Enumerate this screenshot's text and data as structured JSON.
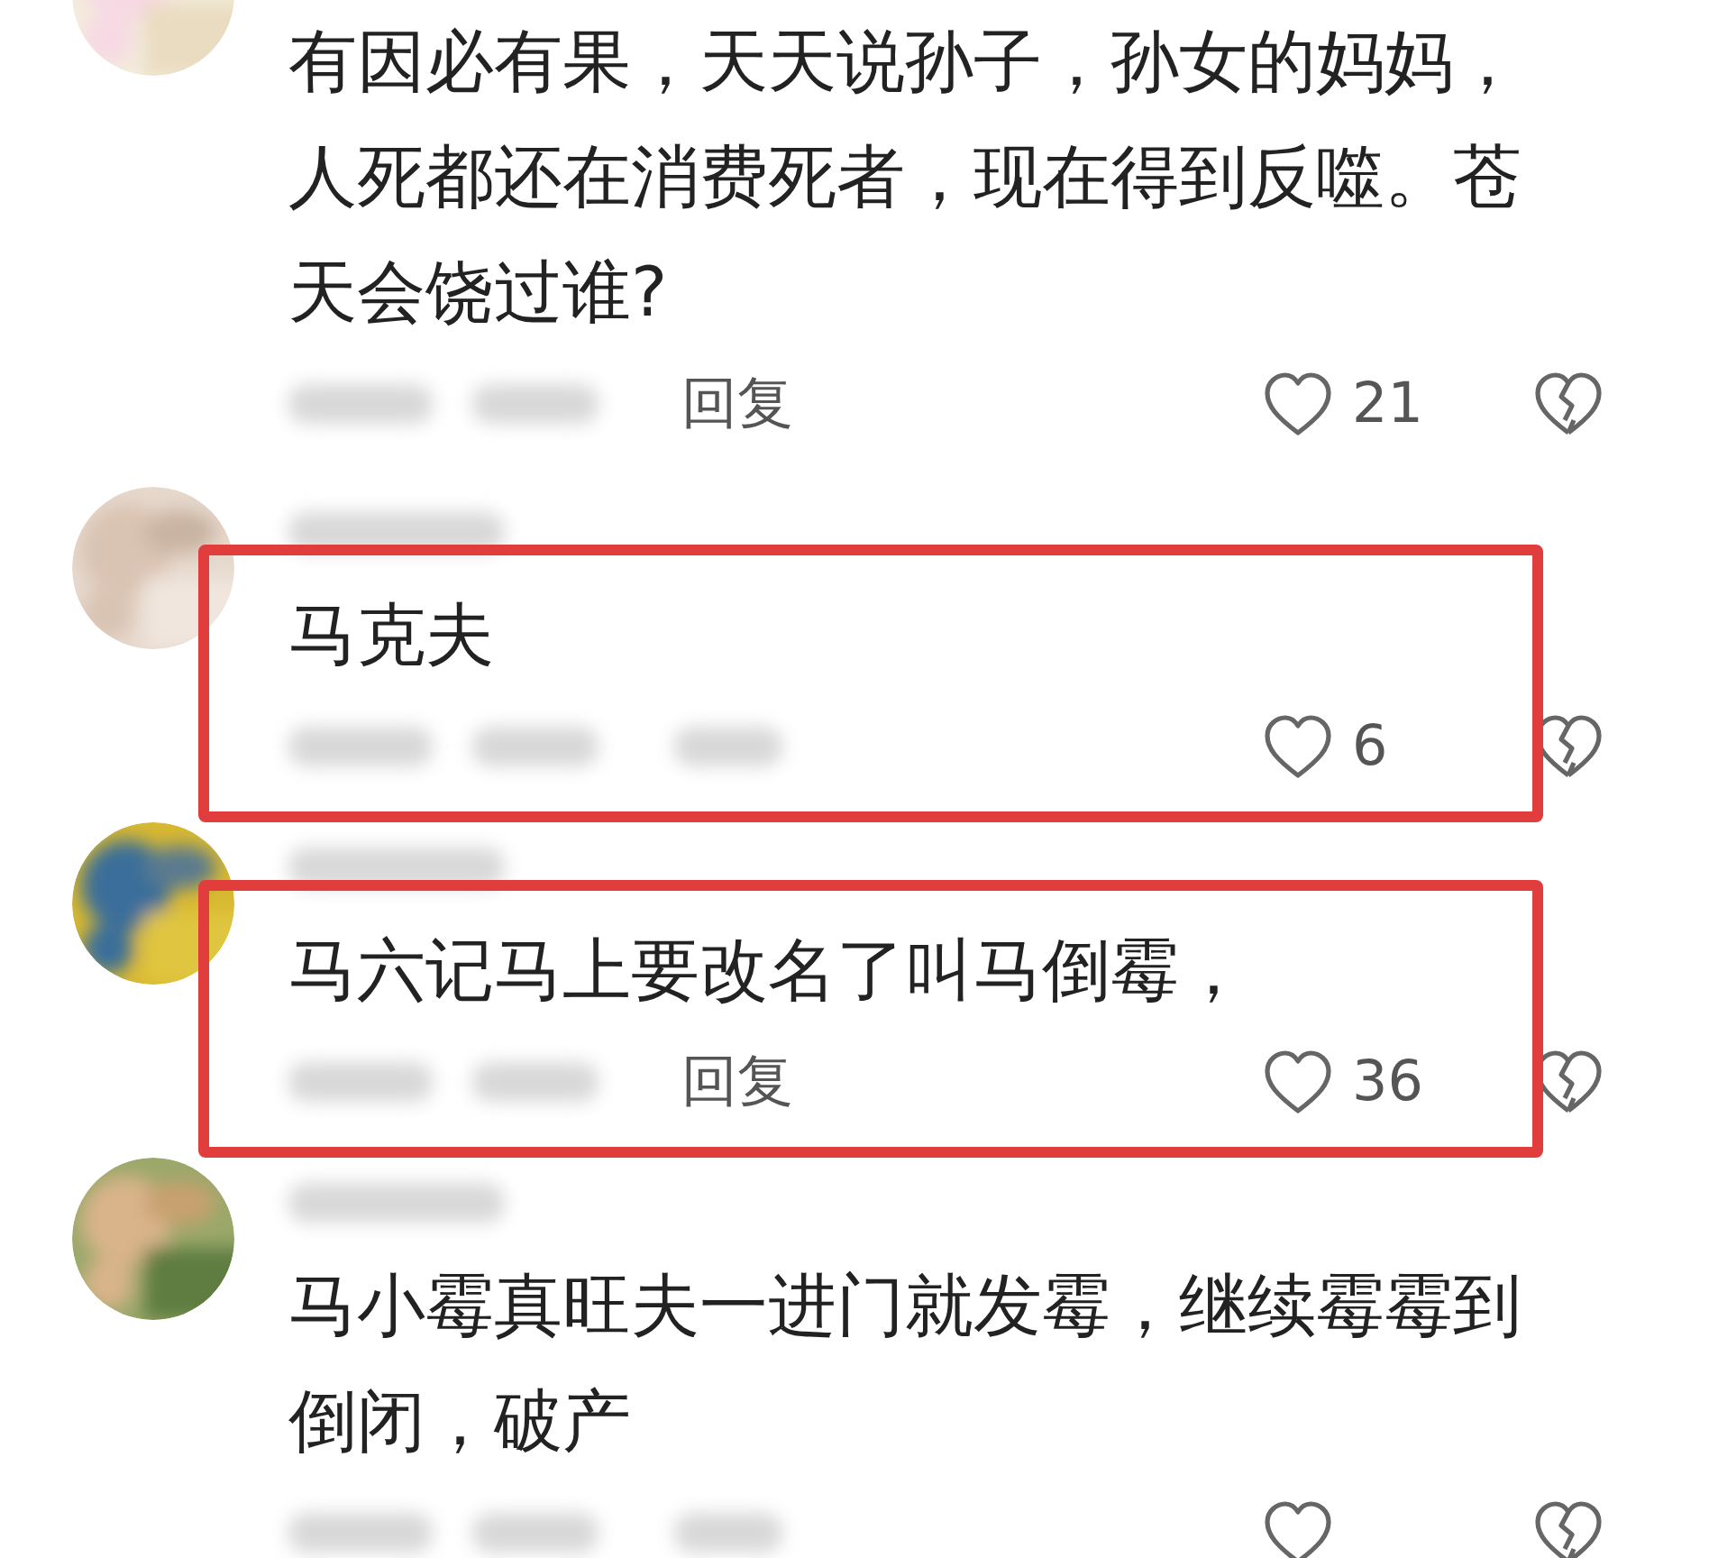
{
  "comments": [
    {
      "text": "有因必有果，天天说孙子，孙女的妈妈，人死都还在消费死者，现在得到反噬。苍天会饶过谁?",
      "reply": "回复",
      "likes": "21",
      "highlighted": false
    },
    {
      "text": "马克夫",
      "likes": "6",
      "highlighted": true
    },
    {
      "text": "马六记马上要改名了叫马倒霉，",
      "reply": "回复",
      "likes": "36",
      "highlighted": true
    },
    {
      "text": "马小霉真旺夫一进门就发霉，继续霉霉到倒闭，破产",
      "highlighted": false
    }
  ]
}
